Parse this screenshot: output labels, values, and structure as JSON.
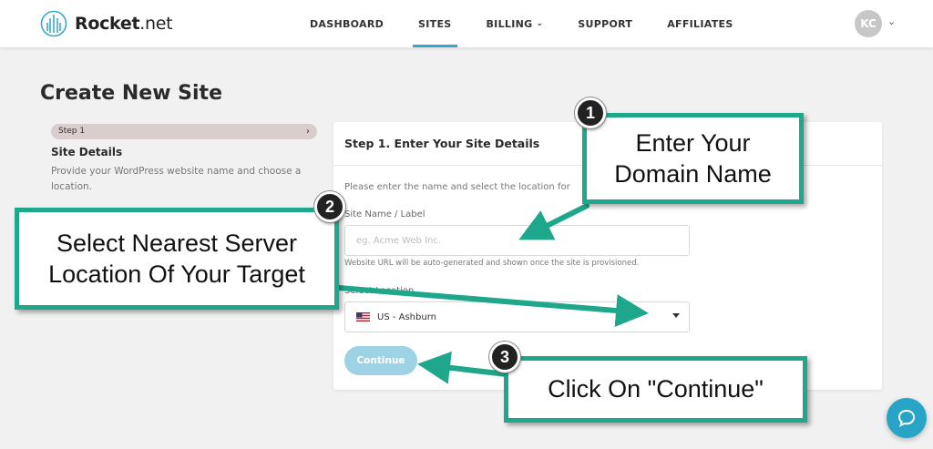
{
  "brand": {
    "name_bold": "Rocket",
    "name_rest": ".net",
    "accent": "#37a8c9"
  },
  "nav": {
    "items": [
      {
        "label": "DASHBOARD"
      },
      {
        "label": "SITES"
      },
      {
        "label": "BILLING"
      },
      {
        "label": "SUPPORT"
      },
      {
        "label": "AFFILIATES"
      }
    ],
    "active": "SITES"
  },
  "user": {
    "initials": "KC"
  },
  "page": {
    "title": "Create New Site"
  },
  "steps": {
    "current_label": "Step 1",
    "title": "Site Details",
    "description": "Provide your WordPress website name and choose a location."
  },
  "form": {
    "heading": "Step 1. Enter Your Site Details",
    "intro": "Please enter the name and select the location for",
    "name_label": "Site Name / Label",
    "name_placeholder": "eg. Acme Web Inc.",
    "name_hint": "Website URL will be auto-generated and shown once the site is provisioned.",
    "location_label": "Select Location",
    "location_value": "US - Ashburn",
    "continue_label": "Continue"
  },
  "annotations": {
    "callout_1": {
      "number": "1",
      "line1": "Enter Your",
      "line2": "Domain Name"
    },
    "callout_2": {
      "number": "2",
      "line1": "Select Nearest Server",
      "line2": "Location Of Your Target"
    },
    "callout_3": {
      "number": "3",
      "text": "Click On \"Continue\""
    },
    "color": "#1ea78a"
  },
  "icons": {
    "chat": "chat-bubble-icon",
    "flag": "us-flag-icon",
    "logo": "rocket-building-icon"
  }
}
